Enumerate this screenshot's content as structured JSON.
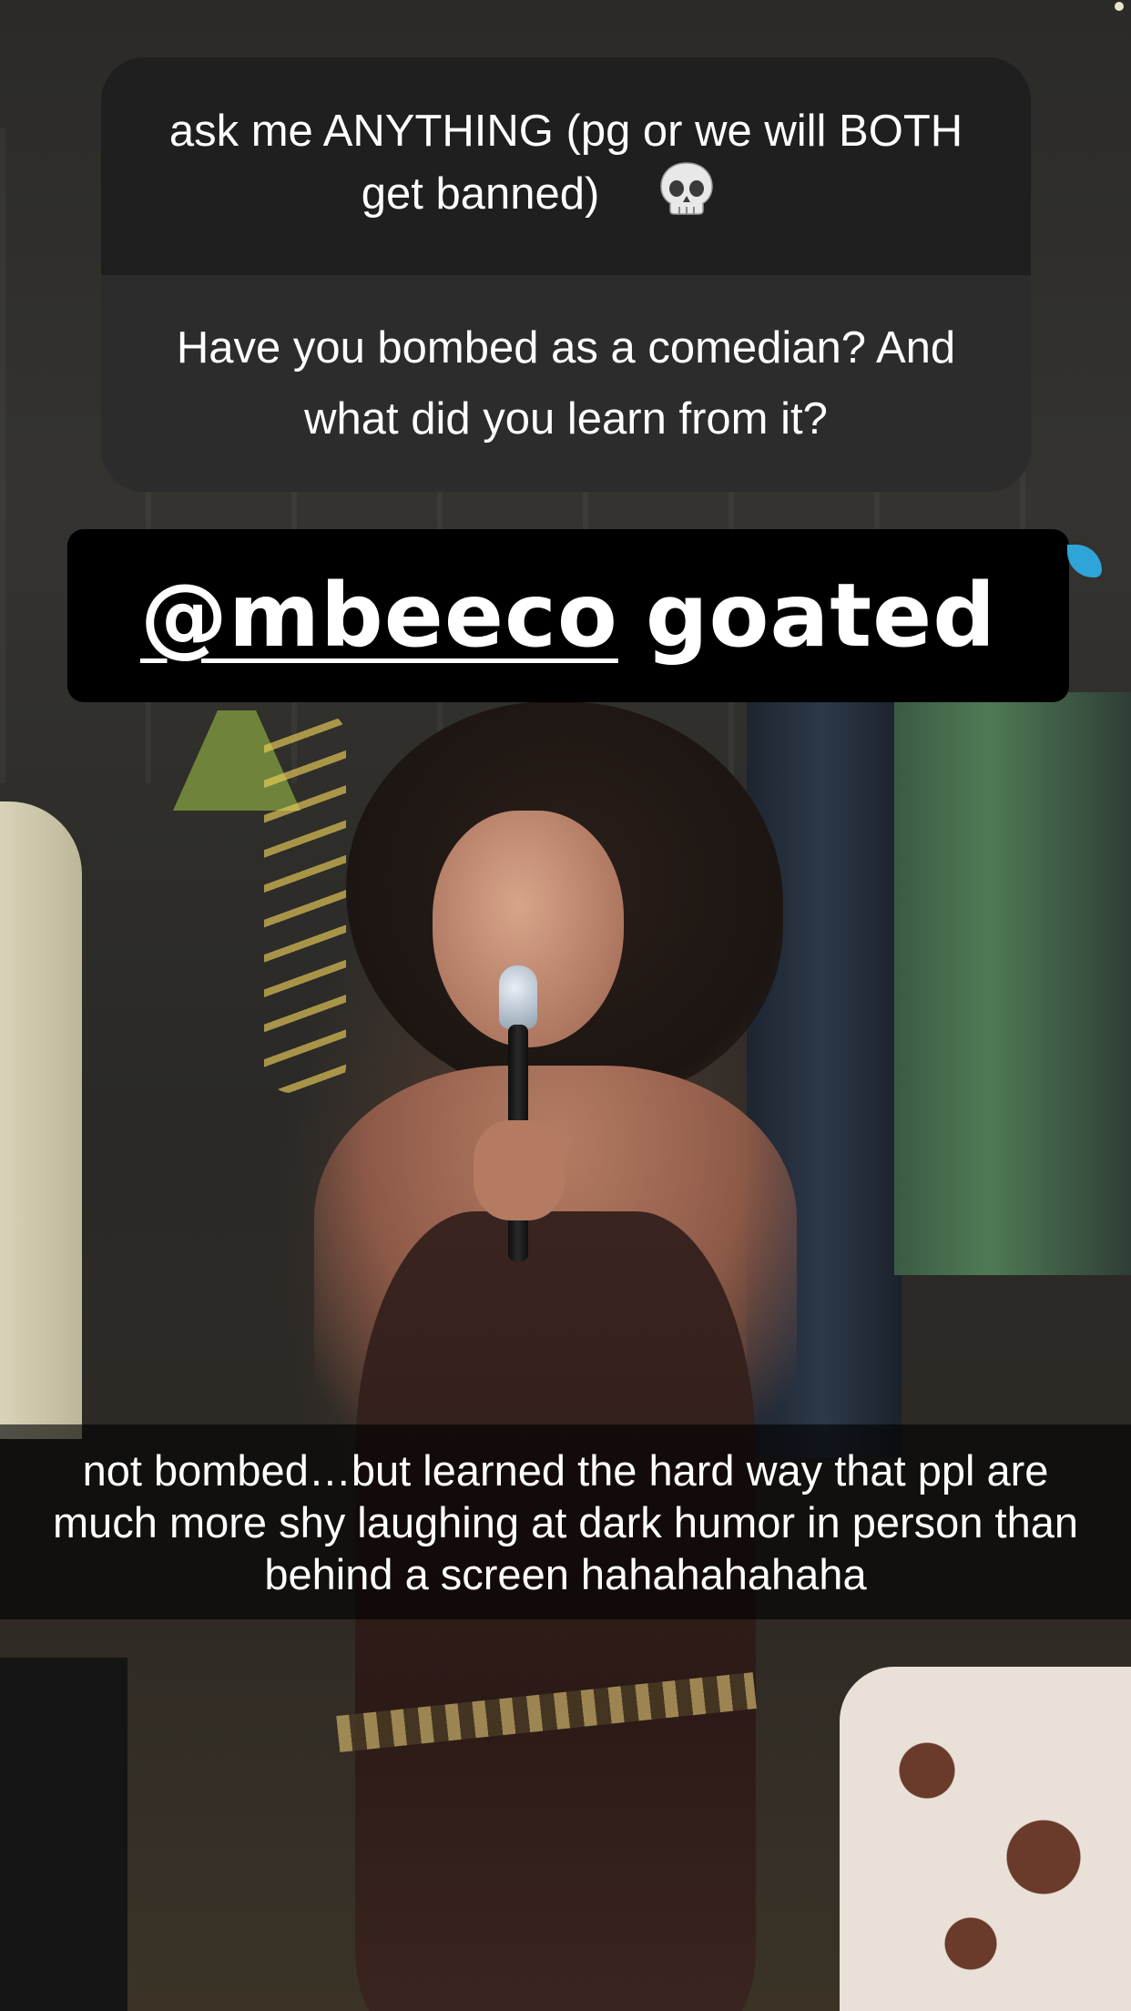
{
  "story": {
    "question_sticker": {
      "prompt": "ask me ANYTHING (pg or we will BOTH get banned)",
      "prompt_emoji": "skull-icon",
      "question": "Have you bombed as a comedian? And what did you learn from it?"
    },
    "mention_tag": {
      "handle": "@mbeeco",
      "text": "goated"
    },
    "reply_caption": "not bombed…but learned the hard way that ppl are much more shy laughing at dark humor in person than behind a screen hahahahahaha"
  },
  "colors": {
    "sticker_header": "#1f1f1f",
    "sticker_body": "#2c2c2c",
    "mention_bg": "#000000",
    "caption_bg": "rgba(0,0,0,0.62)",
    "text": "#ffffff"
  }
}
